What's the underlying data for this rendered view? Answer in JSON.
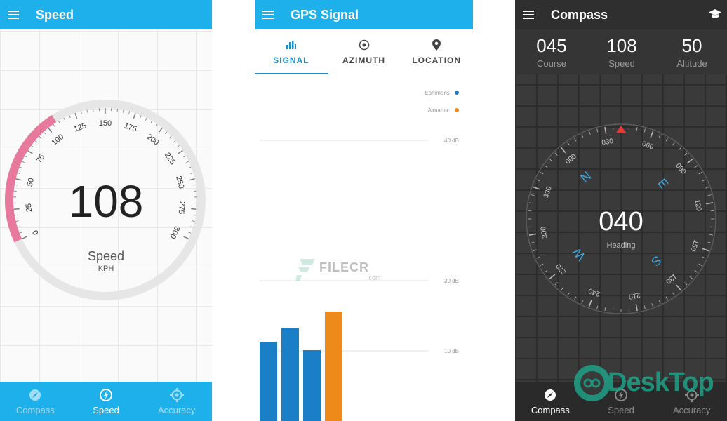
{
  "speed_screen": {
    "title": "Speed",
    "gauge_ticks": [
      "0",
      "25",
      "50",
      "75",
      "100",
      "125",
      "150",
      "175",
      "200",
      "225",
      "250",
      "275",
      "300"
    ],
    "value": "108",
    "label": "Speed",
    "unit": "KPH",
    "nav": [
      {
        "label": "Compass",
        "icon": "compass-icon",
        "active": false
      },
      {
        "label": "Speed",
        "icon": "speedometer-icon",
        "active": true
      },
      {
        "label": "Accuracy",
        "icon": "crosshair-icon",
        "active": false
      }
    ],
    "colors": {
      "accent": "#1eb0ea",
      "gauge_arc": "#e77a9c",
      "nav_inactive": "#a3dcf5"
    }
  },
  "gps_screen": {
    "title": "GPS Signal",
    "tabs": [
      {
        "label": "SIGNAL",
        "icon": "bar-chart-icon",
        "active": true
      },
      {
        "label": "AZIMUTH",
        "icon": "satellite-target-icon",
        "active": false
      },
      {
        "label": "LOCATION",
        "icon": "map-pin-icon",
        "active": false
      }
    ],
    "chart_data": {
      "type": "bar",
      "legend": [
        {
          "name": "Ephimeris",
          "color": "#1a7fc6"
        },
        {
          "name": "Almanac",
          "color": "#ee8a19"
        }
      ],
      "y_ticks": [
        "40 dB",
        "20 dB",
        "10 dB"
      ],
      "series": [
        {
          "name": "Ephimeris",
          "values": [
            11.3,
            13.2,
            10.1
          ]
        },
        {
          "name": "Almanac",
          "values": [
            15.6
          ]
        }
      ]
    },
    "watermark": {
      "text": "FILECR",
      "suffix": ".com"
    }
  },
  "compass_screen": {
    "title": "Compass",
    "stats": [
      {
        "value": "045",
        "label": "Course"
      },
      {
        "value": "108",
        "label": "Speed"
      },
      {
        "value": "50",
        "label": "Altitude"
      }
    ],
    "heading_value": "040",
    "heading_label": "Heading",
    "dial_labels": [
      "030",
      "060",
      "090",
      "120",
      "150",
      "180",
      "210",
      "240",
      "270",
      "300",
      "330",
      "000"
    ],
    "cardinals": [
      "N",
      "E",
      "S",
      "W"
    ],
    "nav": [
      {
        "label": "Compass",
        "icon": "compass-icon",
        "active": true
      },
      {
        "label": "Speed",
        "icon": "speedometer-icon",
        "active": false
      },
      {
        "label": "Accuracy",
        "icon": "crosshair-icon",
        "active": false
      }
    ],
    "colors": {
      "background": "#3a3a3a",
      "accent": "#3fa7e0",
      "marker": "#e53935"
    }
  },
  "watermark": {
    "text": "DeskTop",
    "color": "#1fa187"
  }
}
